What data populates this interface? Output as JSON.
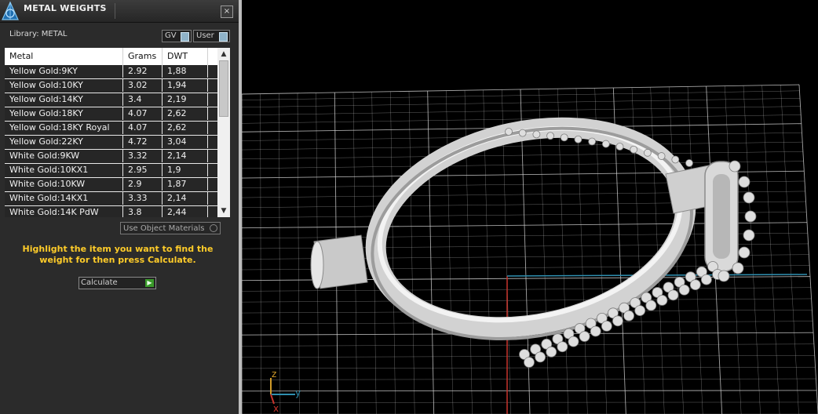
{
  "panel": {
    "title": "METAL WEIGHTS",
    "close_label": "×",
    "library_label": "Library: METAL",
    "toggles": [
      {
        "label": "GV"
      },
      {
        "label": "User"
      }
    ],
    "table": {
      "columns": [
        "Metal",
        "Grams",
        "DWT"
      ],
      "rows": [
        [
          "Yellow Gold:9KY",
          "2.92",
          "1,88"
        ],
        [
          "Yellow Gold:10KY",
          "3.02",
          "1,94"
        ],
        [
          "Yellow Gold:14KY",
          "3.4",
          "2,19"
        ],
        [
          "Yellow Gold:18KY",
          "4.07",
          "2,62"
        ],
        [
          "Yellow Gold:18KY Royal",
          "4.07",
          "2,62"
        ],
        [
          "Yellow Gold:22KY",
          "4.72",
          "3,04"
        ],
        [
          "White Gold:9KW",
          "3.32",
          "2,14"
        ],
        [
          "White Gold:10KX1",
          "2.95",
          "1,9"
        ],
        [
          "White Gold:10KW",
          "2.9",
          "1,87"
        ],
        [
          "White Gold:14KX1",
          "3.33",
          "2,14"
        ],
        [
          "White Gold:14K PdW",
          "3.8",
          "2,44"
        ]
      ]
    },
    "use_object_materials_label": "Use Object Materials",
    "instructions": "Highlight the item you want to find the weight for then press Calculate.",
    "calculate_label": "Calculate"
  },
  "viewport": {
    "axis_labels": {
      "z": "z",
      "y": "y",
      "x": "x"
    },
    "colors": {
      "grid": "#dcdcdc",
      "axis_x": "#c8342c",
      "axis_y": "#2f8fb0",
      "axis_z": "#d09a28",
      "model": "#dedede"
    }
  }
}
